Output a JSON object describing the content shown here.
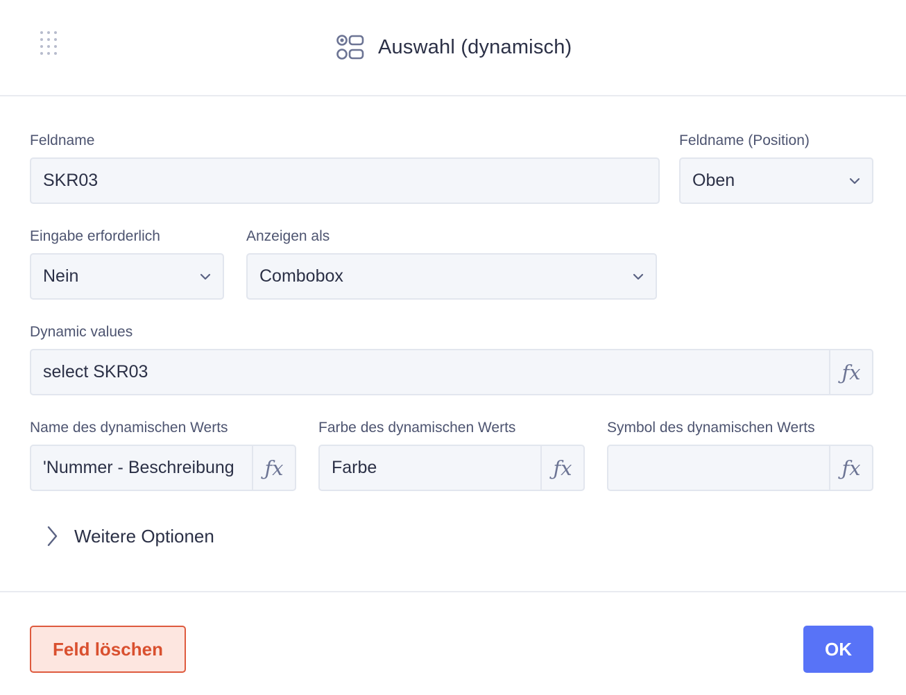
{
  "header": {
    "title": "Auswahl (dynamisch)",
    "drag_icon": "drag-handle-icon",
    "type_icon": "dynamic-select-icon"
  },
  "form": {
    "fieldname": {
      "label": "Feldname",
      "value": "SKR03"
    },
    "fieldname_position": {
      "label": "Feldname (Position)",
      "value": "Oben"
    },
    "required": {
      "label": "Eingabe erforderlich",
      "value": "Nein"
    },
    "display_as": {
      "label": "Anzeigen als",
      "value": "Combobox"
    },
    "dynamic_values": {
      "label": "Dynamic values",
      "value": "select SKR03",
      "fx": "ƒx"
    },
    "value_name": {
      "label": "Name des dynamischen Werts",
      "value": "'Nummer - Beschreibung",
      "fx": "ƒx"
    },
    "value_color": {
      "label": "Farbe des dynamischen Werts",
      "value": "Farbe",
      "fx": "ƒx"
    },
    "value_symbol": {
      "label": "Symbol des dynamischen Werts",
      "value": "",
      "fx": "ƒx"
    }
  },
  "more_options": {
    "label": "Weitere Optionen",
    "icon": "chevron-right-icon"
  },
  "footer": {
    "delete_label": "Feld löschen",
    "ok_label": "OK"
  },
  "colors": {
    "primary": "#5873f7",
    "danger": "#de5a3e",
    "danger_bg": "#fde6e0",
    "field_bg": "#f4f6fa",
    "text": "#2b3046"
  }
}
